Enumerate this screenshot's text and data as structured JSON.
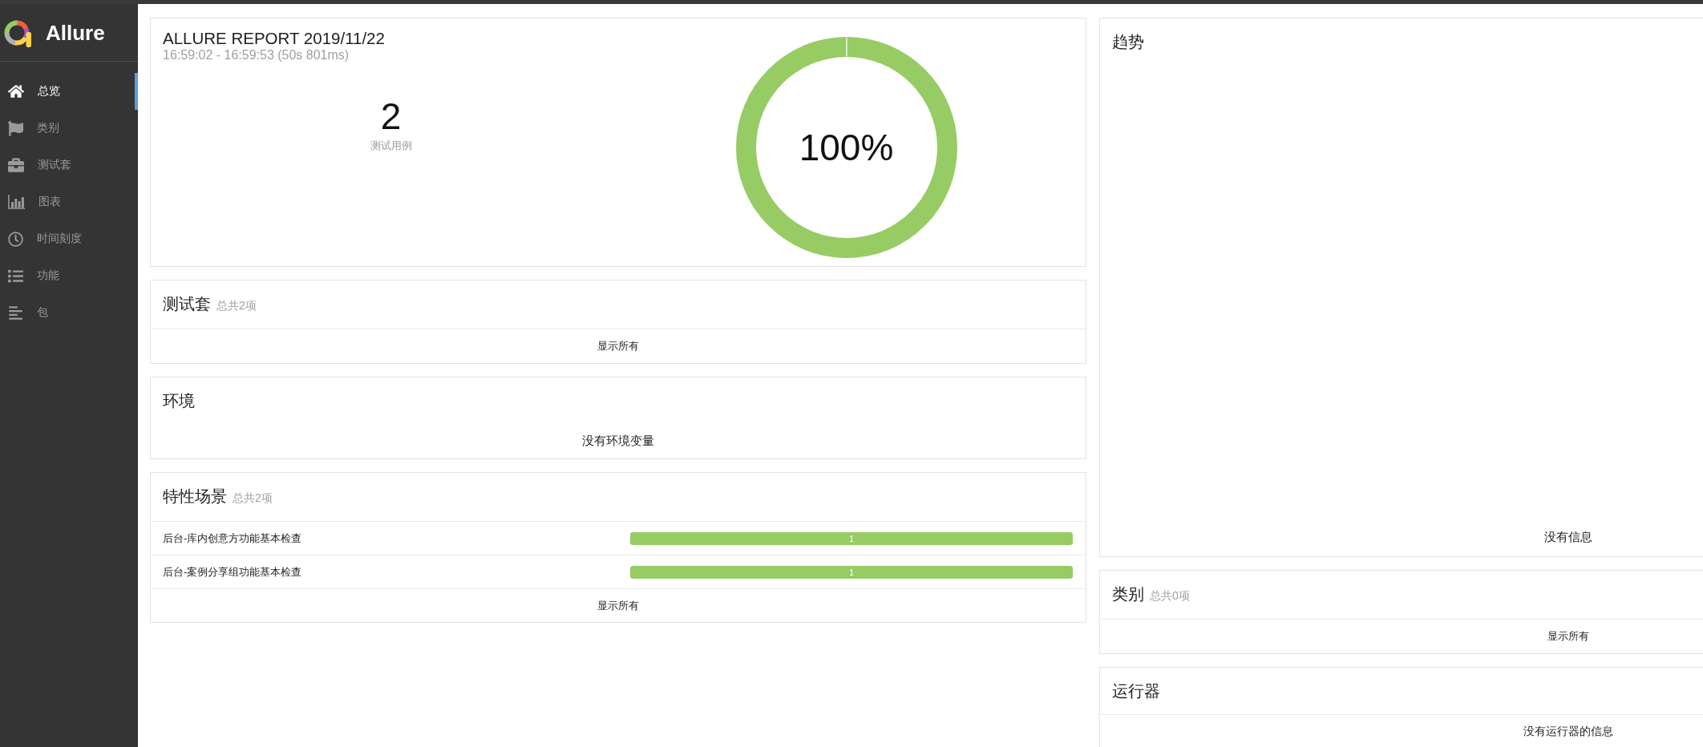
{
  "sidebar": {
    "brand": "Allure",
    "items": [
      {
        "label": "总览",
        "selected": true
      },
      {
        "label": "类别",
        "selected": false
      },
      {
        "label": "测试套",
        "selected": false
      },
      {
        "label": "图表",
        "selected": false
      },
      {
        "label": "时间刻度",
        "selected": false
      },
      {
        "label": "功能",
        "selected": false
      },
      {
        "label": "包",
        "selected": false
      }
    ]
  },
  "summary": {
    "title": "ALLURE REPORT 2019/11/22",
    "time_range": "16:59:02 - 16:59:53 (50s 801ms)",
    "test_count": "2",
    "test_count_label": "测试用例",
    "success_rate": {
      "label": "100%",
      "level": 1
    }
  },
  "suites": {
    "title": "测试套",
    "count": "总共2项",
    "footer": "显示所有"
  },
  "environment": {
    "title": "环境",
    "message": "没有环境变量"
  },
  "features": {
    "title": "特性场景",
    "count": "总共2项",
    "rows": [
      {
        "name": "后台-库内创意方功能基本检查",
        "value": "1",
        "level": 1
      },
      {
        "name": "后台-案例分享组功能基本检查",
        "value": "1",
        "level": 1
      }
    ],
    "footer": "显示所有"
  },
  "trend": {
    "title": "趋势",
    "message": "没有信息"
  },
  "categories": {
    "title": "类别",
    "count": "总共0项",
    "footer": "显示所有"
  },
  "executors": {
    "title": "运行器",
    "message": "没有运行器的信息"
  }
}
